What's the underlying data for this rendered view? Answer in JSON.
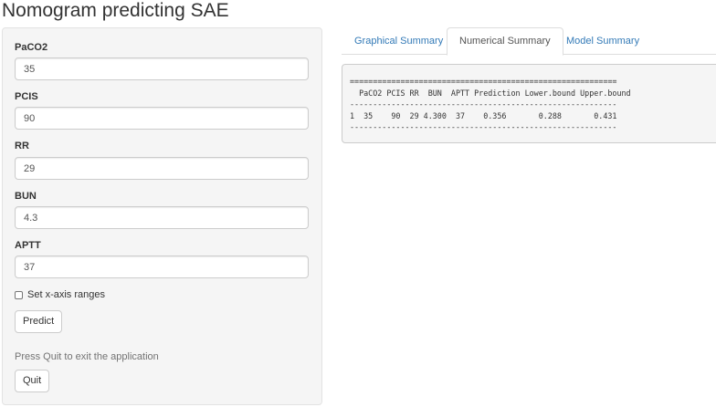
{
  "app": {
    "title": "Nomogram predicting SAE"
  },
  "sidebar": {
    "fields": [
      {
        "label": "PaCO2",
        "value": "35"
      },
      {
        "label": "PCIS",
        "value": "90"
      },
      {
        "label": "RR",
        "value": "29"
      },
      {
        "label": "BUN",
        "value": "4.3"
      },
      {
        "label": "APTT",
        "value": "37"
      }
    ],
    "checkbox_label": "Set x-axis ranges",
    "checkbox_checked": false,
    "predict_label": "Predict",
    "quit_help": "Press Quit to exit the application",
    "quit_label": "Quit"
  },
  "tabs": [
    {
      "label": "Graphical Summary",
      "active": false
    },
    {
      "label": "Numerical Summary",
      "active": true
    },
    {
      "label": "Model Summary",
      "active": false
    }
  ],
  "output": {
    "separator_top": "==========================================================",
    "header": "  PaCO2 PCIS RR  BUN  APTT Prediction Lower.bound Upper.bound",
    "separator_mid": "----------------------------------------------------------",
    "row": "1  35    90  29 4.300  37    0.356       0.288       0.431",
    "separator_bottom": "----------------------------------------------------------"
  },
  "colors": {
    "link": "#337ab7",
    "well_bg": "#f5f5f5"
  }
}
